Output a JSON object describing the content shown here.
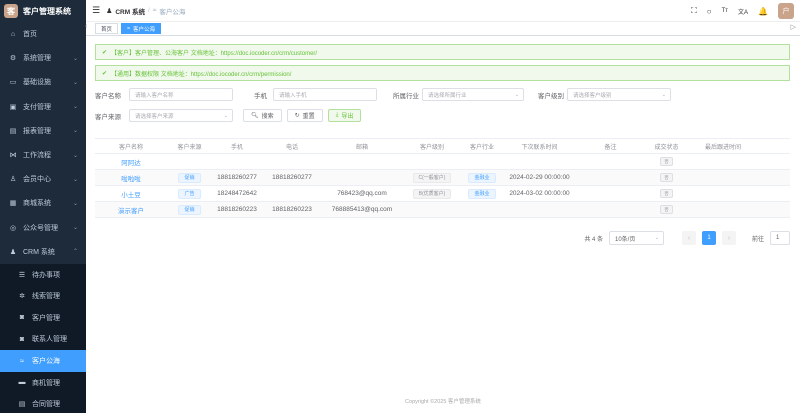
{
  "app": {
    "title": "客户管理系统",
    "logo_char": "客",
    "user_char": "户"
  },
  "sidebar": {
    "items": [
      {
        "label": "首页",
        "icon": "home-icon",
        "glyph": "⌂",
        "chevron": false
      },
      {
        "label": "系统管理",
        "icon": "gear-icon",
        "glyph": "⚙",
        "chevron": true
      },
      {
        "label": "基础设施",
        "icon": "monitor-icon",
        "glyph": "▭",
        "chevron": true
      },
      {
        "label": "支付管理",
        "icon": "wallet-icon",
        "glyph": "▣",
        "chevron": true
      },
      {
        "label": "报表管理",
        "icon": "chart-icon",
        "glyph": "▤",
        "chevron": true
      },
      {
        "label": "工作流程",
        "icon": "flow-icon",
        "glyph": "⋈",
        "chevron": true
      },
      {
        "label": "会员中心",
        "icon": "member-icon",
        "glyph": "♙",
        "chevron": true
      },
      {
        "label": "商城系统",
        "icon": "shop-icon",
        "glyph": "▦",
        "chevron": true
      },
      {
        "label": "公众号管理",
        "icon": "wechat-icon",
        "glyph": "◎",
        "chevron": true
      },
      {
        "label": "CRM 系统",
        "icon": "user-icon",
        "glyph": "♟",
        "chevron": true,
        "open": true
      }
    ],
    "crm_children": [
      {
        "label": "待办事项",
        "icon": "list-icon",
        "glyph": "☰"
      },
      {
        "label": "线索管理",
        "icon": "clue-icon",
        "glyph": "✲"
      },
      {
        "label": "客户管理",
        "icon": "customer-icon",
        "glyph": "◙"
      },
      {
        "label": "联系人管理",
        "icon": "contact-icon",
        "glyph": "◙"
      },
      {
        "label": "客户公海",
        "icon": "pool-icon",
        "glyph": "≈",
        "active": true
      },
      {
        "label": "商机管理",
        "icon": "opportunity-icon",
        "glyph": "▬"
      },
      {
        "label": "合同管理",
        "icon": "contract-icon",
        "glyph": "▤"
      }
    ]
  },
  "navbar": {
    "breadcrumb_1": "CRM 系统",
    "breadcrumb_sep": "/",
    "breadcrumb_2": "客户公海",
    "icons": [
      "fullscreen-icon",
      "search-icon",
      "font-size-icon",
      "translate-icon",
      "bell-icon"
    ],
    "icon_glyphs": [
      "⛶",
      "○",
      "Tт",
      "文A",
      "🔔"
    ]
  },
  "tags": [
    {
      "label": "首页",
      "active": false
    },
    {
      "label": "客户公海",
      "active": true
    }
  ],
  "alerts": [
    {
      "text": "【客户】客户管理、公海客户 文档地址：https://doc.iocoder.cn/crm/customer/"
    },
    {
      "text": "【通用】数据权限 文档地址：https://doc.iocoder.cn/crm/permission/"
    }
  ],
  "filters": {
    "name_label": "客户名称",
    "name_placeholder": "请输入客户名称",
    "mobile_label": "手机",
    "mobile_placeholder": "请输入手机",
    "industry_label": "所属行业",
    "industry_placeholder": "请选择所属行业",
    "level_label": "客户级别",
    "level_placeholder": "请选择客户级别",
    "source_label": "客户来源",
    "source_placeholder": "请选择客户来源",
    "search_btn": "搜索",
    "reset_btn": "重置",
    "export_btn": "导出"
  },
  "table": {
    "headers": [
      "客户名称",
      "客户来源",
      "手机",
      "电话",
      "邮箱",
      "客户级别",
      "客户行业",
      "下次联系时间",
      "备注",
      "成交状态",
      "最后跟进时间"
    ],
    "rows": [
      {
        "name": "阿阿达",
        "source": "",
        "mobile": "",
        "phone": "",
        "email": "",
        "level": "",
        "industry": "",
        "next": "",
        "remark": "",
        "status": "否",
        "last": ""
      },
      {
        "name": "啦啦啦",
        "source": "促销",
        "mobile": "18818260277",
        "phone": "18818260277",
        "email": "",
        "level": "C(一般客户)",
        "industry": "金融业",
        "next": "2024-02-29 00:00:00",
        "remark": "",
        "status": "否",
        "last": ""
      },
      {
        "name": "小土豆",
        "source": "广告",
        "mobile": "18248472642",
        "phone": "",
        "email": "768423@qq.com",
        "level": "B(优质客户)",
        "industry": "金融业",
        "next": "2024-03-02 00:00:00",
        "remark": "",
        "status": "否",
        "last": ""
      },
      {
        "name": "演示客户",
        "source": "促销",
        "mobile": "18818260223",
        "phone": "18818260223",
        "email": "768885413@qq.com",
        "level": "",
        "industry": "",
        "next": "",
        "remark": "",
        "status": "否",
        "last": ""
      }
    ]
  },
  "pagination": {
    "total": "共 4 条",
    "page_size": "10条/页",
    "current": "1",
    "goto_label": "前往",
    "goto_value": "1"
  },
  "footer": "Copyright ©2025 客户管理系统"
}
